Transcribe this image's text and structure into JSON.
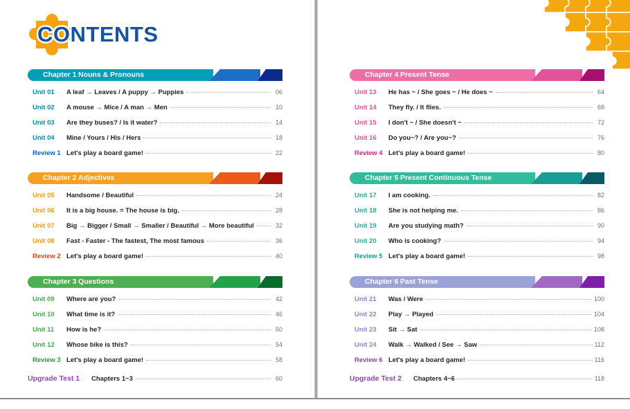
{
  "logo": {
    "text": "CONTENTS",
    "color": "#15539e",
    "puzzle_color": "#f5a213"
  },
  "decorations": {
    "corner_puzzle": "puzzle-pieces-orange",
    "corner_puzzle_color": "#f5a70f"
  },
  "left_page": {
    "chapters": [
      {
        "number": "Chapter 1",
        "title": "Nouns & Pronouns",
        "colors": {
          "main": "#00a0b8",
          "mid": "#1b6fc4",
          "end": "#0a2a8e",
          "unit": "#0091ad",
          "review": "#0066cc"
        },
        "units": [
          {
            "label": "Unit 01",
            "title": "A leaf → Leaves / A puppy → Puppies",
            "page": "06",
            "review": false
          },
          {
            "label": "Unit 02",
            "title": "A mouse → Mice / A man → Men",
            "page": "10",
            "review": false
          },
          {
            "label": "Unit 03",
            "title": "Are they buses? / Is it water?",
            "page": "14",
            "review": false
          },
          {
            "label": "Unit 04",
            "title": "Mine / Yours / His / Hers",
            "page": "18",
            "review": false
          },
          {
            "label": "Review 1",
            "title": "Let's play a board game!",
            "page": "22",
            "review": true
          }
        ]
      },
      {
        "number": "Chapter 2",
        "title": "Adjectives",
        "colors": {
          "main": "#f5a01e",
          "mid": "#ee5a18",
          "end": "#a41208",
          "unit": "#f39c12",
          "review": "#e8400f"
        },
        "units": [
          {
            "label": "Unit 05",
            "title": "Handsome / Beautiful",
            "page": "24",
            "review": false
          },
          {
            "label": "Unit 06",
            "title": "It is a big house. = The house is big.",
            "page": "28",
            "review": false
          },
          {
            "label": "Unit 07",
            "title": "Big → Bigger / Small → Smaller / Beautiful → More beautiful",
            "page": "32",
            "review": false
          },
          {
            "label": "Unit 08",
            "title": "Fast - Faster - The fastest, The most famous",
            "page": "36",
            "review": false
          },
          {
            "label": "Review 2",
            "title": "Let's play a board game!",
            "page": "40",
            "review": true
          }
        ]
      },
      {
        "number": "Chapter 3",
        "title": "Questions",
        "colors": {
          "main": "#4cb050",
          "mid": "#22a34a",
          "end": "#0b6b2d",
          "unit": "#43ab4a",
          "review": "#1e9e45"
        },
        "units": [
          {
            "label": "Unit 09",
            "title": "Where are you?",
            "page": "42",
            "review": false
          },
          {
            "label": "Unit 10",
            "title": "What time is it?",
            "page": "46",
            "review": false
          },
          {
            "label": "Unit 11",
            "title": "How is he?",
            "page": "50",
            "review": false
          },
          {
            "label": "Unit 12",
            "title": "Whose bike is this?",
            "page": "54",
            "review": false
          },
          {
            "label": "Review 3",
            "title": "Let's play a board game!",
            "page": "58",
            "review": true
          }
        ]
      }
    ],
    "upgrade": {
      "label": "Upgrade Test 1",
      "title": "Chapters 1~3",
      "page": "60",
      "color": "#9b3fb5"
    }
  },
  "right_page": {
    "chapters": [
      {
        "number": "Chapter 4",
        "title": "Present Tense",
        "colors": {
          "main": "#ee6fa8",
          "mid": "#e1539a",
          "end": "#a41070",
          "unit": "#ec4d96",
          "review": "#e01f7e"
        },
        "units": [
          {
            "label": "Unit 13",
            "title": "He has ~ / She goes ~ / He does ~",
            "page": "64",
            "review": false
          },
          {
            "label": "Unit 14",
            "title": "They fly. / It flies.",
            "page": "68",
            "review": false
          },
          {
            "label": "Unit 15",
            "title": "I don't ~ / She doesn't ~",
            "page": "72",
            "review": false
          },
          {
            "label": "Unit 16",
            "title": "Do you~? / Are you~?",
            "page": "76",
            "review": false
          },
          {
            "label": "Review 4",
            "title": "Let's play a board game!",
            "page": "80",
            "review": true
          }
        ]
      },
      {
        "number": "Chapter 5",
        "title": "Present Continuous Tense",
        "colors": {
          "main": "#31bc9b",
          "mid": "#1a9e93",
          "end": "#0b5a68",
          "unit": "#23b396",
          "review": "#12a18c"
        },
        "units": [
          {
            "label": "Unit 17",
            "title": "I am cooking.",
            "page": "82",
            "review": false
          },
          {
            "label": "Unit 18",
            "title": "She is not helping me.",
            "page": "86",
            "review": false
          },
          {
            "label": "Unit 19",
            "title": "Are you studying math?",
            "page": "90",
            "review": false
          },
          {
            "label": "Unit 20",
            "title": "Who is cooking?",
            "page": "94",
            "review": false
          },
          {
            "label": "Review 5",
            "title": "Let's play a board game!",
            "page": "98",
            "review": true
          }
        ]
      },
      {
        "number": "Chapter 6",
        "title": "Past Tense",
        "colors": {
          "main": "#9aa2d8",
          "mid": "#a269c4",
          "end": "#7d1fa8",
          "unit": "#7f8cd1",
          "review": "#8e44ad"
        },
        "units": [
          {
            "label": "Unit 21",
            "title": "Was / Were",
            "page": "100",
            "review": false
          },
          {
            "label": "Unit 22",
            "title": "Play → Played",
            "page": "104",
            "review": false
          },
          {
            "label": "Unit 23",
            "title": "Sit → Sat",
            "page": "108",
            "review": false
          },
          {
            "label": "Unit 24",
            "title": "Walk → Walked / See → Saw",
            "page": "112",
            "review": false
          },
          {
            "label": "Review 6",
            "title": "Let's play a board game!",
            "page": "116",
            "review": true
          }
        ]
      }
    ],
    "upgrade": {
      "label": "Upgrade Test 2",
      "title": "Chapters 4~6",
      "page": "118",
      "color": "#9b3fb5"
    }
  }
}
